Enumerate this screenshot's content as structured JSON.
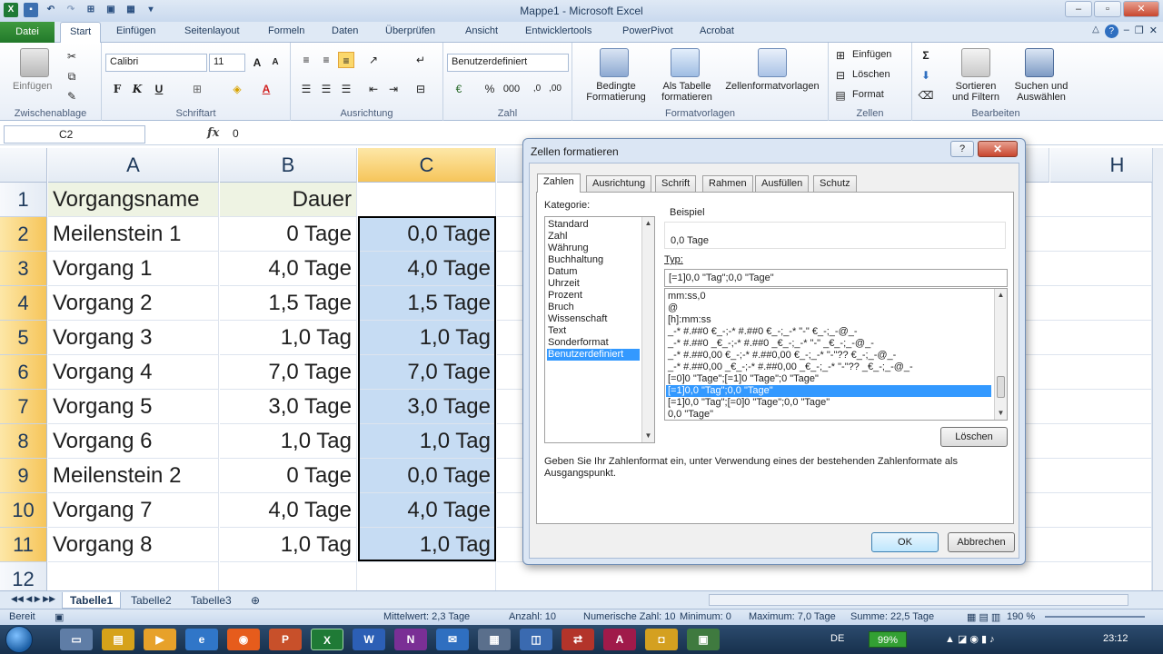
{
  "window": {
    "title": "Mappe1 - Microsoft Excel"
  },
  "ribbon_tabs": [
    "Datei",
    "Start",
    "Einfügen",
    "Seitenlayout",
    "Formeln",
    "Daten",
    "Überprüfen",
    "Ansicht",
    "Entwicklertools",
    "PowerPivot",
    "Acrobat"
  ],
  "ribbon": {
    "clipboard": {
      "paste": "Einfügen",
      "label": "Zwischenablage"
    },
    "font": {
      "name": "Calibri",
      "size": "11",
      "bold": "F",
      "italic": "K",
      "underline": "U",
      "label": "Schriftart"
    },
    "alignment": {
      "label": "Ausrichtung"
    },
    "number": {
      "format": "Benutzerdefiniert",
      "label": "Zahl",
      "percent": "%",
      "thousands": "000"
    },
    "styles": {
      "conditional": "Bedingte\nFormatierung",
      "as_table": "Als Tabelle\nformatieren",
      "cell_styles": "Zellenformatvorlagen",
      "label": "Formatvorlagen"
    },
    "cells": {
      "insert": "Einfügen",
      "delete": "Löschen",
      "format": "Format",
      "label": "Zellen"
    },
    "editing": {
      "sort": "Sortieren\nund Filtern",
      "find": "Suchen und\nAuswählen",
      "label": "Bearbeiten"
    }
  },
  "formula_bar": {
    "name_box": "C2",
    "fx": "fx",
    "value": "0"
  },
  "grid": {
    "columns": [
      "A",
      "B",
      "C",
      "H"
    ],
    "rows": [
      "1",
      "2",
      "3",
      "4",
      "5",
      "6",
      "7",
      "8",
      "9",
      "10",
      "11",
      "12"
    ],
    "data": [
      [
        "Vorgangsname",
        "Dauer",
        ""
      ],
      [
        "Meilenstein 1",
        "0 Tage",
        "0,0 Tage"
      ],
      [
        "Vorgang 1",
        "4,0 Tage",
        "4,0 Tage"
      ],
      [
        "Vorgang 2",
        "1,5 Tage",
        "1,5 Tage"
      ],
      [
        "Vorgang 3",
        "1,0 Tag",
        "1,0 Tag"
      ],
      [
        "Vorgang 4",
        "7,0 Tage",
        "7,0 Tage"
      ],
      [
        "Vorgang 5",
        "3,0 Tage",
        "3,0 Tage"
      ],
      [
        "Vorgang 6",
        "1,0 Tag",
        "1,0 Tag"
      ],
      [
        "Meilenstein 2",
        "0 Tage",
        "0,0 Tage"
      ],
      [
        "Vorgang 7",
        "4,0 Tage",
        "4,0 Tage"
      ],
      [
        "Vorgang 8",
        "1,0 Tag",
        "1,0 Tag"
      ],
      [
        "",
        "",
        ""
      ]
    ]
  },
  "sheets": [
    "Tabelle1",
    "Tabelle2",
    "Tabelle3"
  ],
  "status": {
    "mode": "Bereit",
    "average": "Mittelwert: 2,3 Tage",
    "count": "Anzahl: 10",
    "numcount": "Numerische Zahl: 10",
    "min": "Minimum: 0",
    "max": "Maximum: 7,0 Tage",
    "sum": "Summe: 22,5 Tage",
    "zoom": "190 %"
  },
  "taskbar": {
    "lang": "DE",
    "battery": "99%",
    "time": "23:12"
  },
  "dialog": {
    "title": "Zellen formatieren",
    "help": "?",
    "close": "✕",
    "tabs": [
      "Zahlen",
      "Ausrichtung",
      "Schrift",
      "Rahmen",
      "Ausfüllen",
      "Schutz"
    ],
    "category_label": "Kategorie:",
    "categories": [
      "Standard",
      "Zahl",
      "Währung",
      "Buchhaltung",
      "Datum",
      "Uhrzeit",
      "Prozent",
      "Bruch",
      "Wissenschaft",
      "Text",
      "Sonderformat",
      "Benutzerdefiniert"
    ],
    "sample_label": "Beispiel",
    "sample_value": "0,0 Tage",
    "type_label": "Typ:",
    "type_value": "[=1]0,0 \"Tag\";0,0 \"Tage\"",
    "formats": [
      "mm:ss,0",
      "@",
      "[h]:mm:ss",
      "_-* #.##0 €_-;-* #.##0 €_-;_-* \"-\" €_-;_-@_-",
      "_-* #.##0 _€_-;-* #.##0 _€_-;_-* \"-\" _€_-;_-@_-",
      "_-* #.##0,00 €_-;-* #.##0,00 €_-;_-* \"-\"?? €_-;_-@_-",
      "_-* #.##0,00 _€_-;-* #.##0,00 _€_-;_-* \"-\"?? _€_-;_-@_-",
      "[=0]0 \"Tage\";[=1]0 \"Tage\";0 \"Tage\"",
      "[=1]0,0 \"Tag\";0,0 \"Tage\"",
      "[=1]0,0 \"Tag\";[=0]0 \"Tage\";0,0 \"Tage\"",
      "0,0 \"Tage\""
    ],
    "delete_btn": "Löschen",
    "hint": "Geben Sie Ihr Zahlenformat ein, unter Verwendung eines der bestehenden Zahlenformate als Ausgangspunkt.",
    "ok": "OK",
    "cancel": "Abbrechen"
  },
  "colors": {
    "selection": "#c6dcf3",
    "header_selected": "#f6c55a",
    "list_selected": "#3399ff",
    "excel_green": "#22792a"
  }
}
